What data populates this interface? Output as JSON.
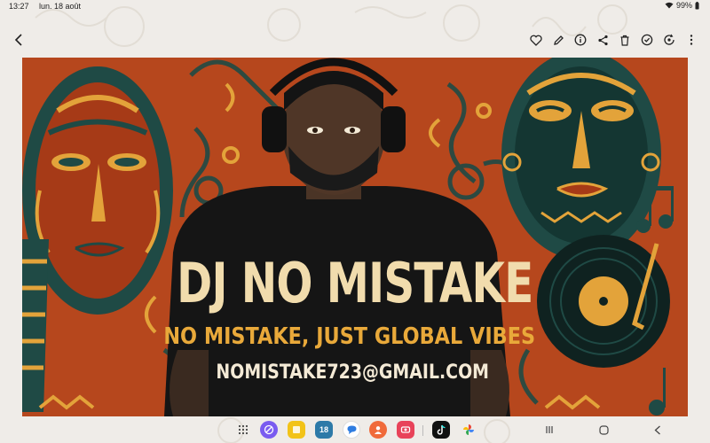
{
  "status": {
    "time": "13:27",
    "date": "lun. 18 août",
    "battery": "99%"
  },
  "toolbar": {
    "back_icon": "chevron-left-icon",
    "actions": [
      "favorite-heart-icon",
      "edit-pencil-icon",
      "info-icon",
      "share-icon",
      "delete-trash-icon",
      "remaster-icon",
      "auto-enhance-icon",
      "more-options-icon"
    ]
  },
  "poster": {
    "title": "DJ NO MISTAKE",
    "tagline": "NO MISTAKE, JUST GLOBAL VIBES",
    "email": "NOMISTAKE723@GMAIL.COM",
    "colors": {
      "background": "#b6471d",
      "title": "#f1dcad",
      "tagline": "#e9a93a",
      "email": "#f4ead6"
    }
  },
  "dock": {
    "apps": [
      "apps-grid-icon",
      "internet-icon",
      "notes-icon",
      "calendar-icon",
      "messages-icon",
      "contacts-icon",
      "screen-recorder-icon",
      "tiktok-icon",
      "photos-icon"
    ],
    "calendar_day": "18",
    "nav": [
      "recent-apps-icon",
      "home-icon",
      "back-icon"
    ]
  }
}
